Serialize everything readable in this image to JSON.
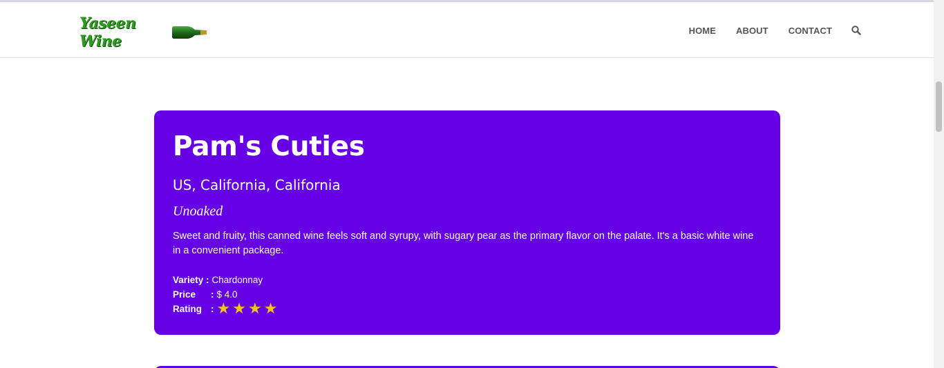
{
  "header": {
    "logo": {
      "text": "Yaseen Wine"
    },
    "nav": {
      "home": "HOME",
      "about": "ABOUT",
      "contact": "CONTACT",
      "search_icon": "search-icon"
    }
  },
  "wine": {
    "title": "Pam's Cuties",
    "region": "US, California, California",
    "designation": "Unoaked",
    "description": "Sweet and fruity, this canned wine feels soft and syrupy, with sugary pear as the primary flavor on the palate. It's a basic white wine in a convenient package.",
    "variety_label": "Variety :",
    "variety": "Chardonnay",
    "price_label": "Price",
    "price_sep": ":",
    "price": "$ 4.0",
    "rating_label": "Rating",
    "rating_sep": ":",
    "rating_stars": 4
  },
  "colors": {
    "card_bg": "#6600e5",
    "star": "#f4c21c",
    "nav_text": "#555555"
  }
}
